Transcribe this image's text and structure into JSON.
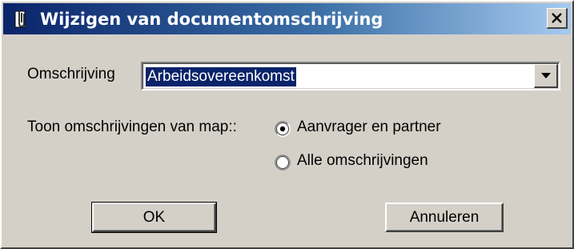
{
  "window": {
    "title": "Wijzigen van documentomschrijving",
    "icon": "document-clip-icon",
    "close_icon": "close-icon"
  },
  "form": {
    "description_label": "Omschrijving",
    "description_value": "Arbeidsovereenkomst",
    "folder_label": "Toon omschrijvingen van map::",
    "radio_options": [
      {
        "label": "Aanvrager en partner",
        "selected": true
      },
      {
        "label": "Alle omschrijvingen",
        "selected": false
      }
    ]
  },
  "buttons": {
    "ok_label": "OK",
    "cancel_label": "Annuleren"
  },
  "colors": {
    "face": "#d4d0c8",
    "title_start": "#0a246a",
    "title_end": "#a6caf0",
    "selection": "#0a246a"
  }
}
